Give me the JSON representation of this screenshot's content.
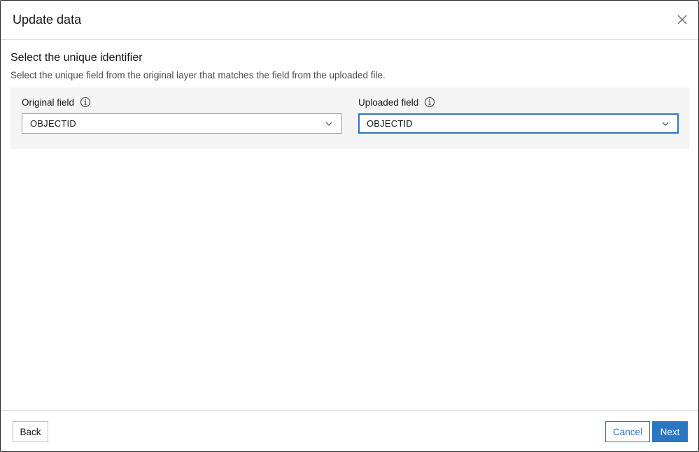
{
  "dialog": {
    "title": "Update data",
    "close_icon": "close-icon"
  },
  "section": {
    "title": "Select the unique identifier",
    "description": "Select the unique field from the original layer that matches the field from the uploaded file."
  },
  "fields": {
    "original": {
      "label": "Original field",
      "info_icon": "info-icon",
      "value": "OBJECTID"
    },
    "uploaded": {
      "label": "Uploaded field",
      "info_icon": "info-icon",
      "value": "OBJECTID"
    }
  },
  "footer": {
    "back_label": "Back",
    "cancel_label": "Cancel",
    "next_label": "Next"
  },
  "colors": {
    "accent": "#2a76c3",
    "panel_bg": "#f4f4f4"
  }
}
